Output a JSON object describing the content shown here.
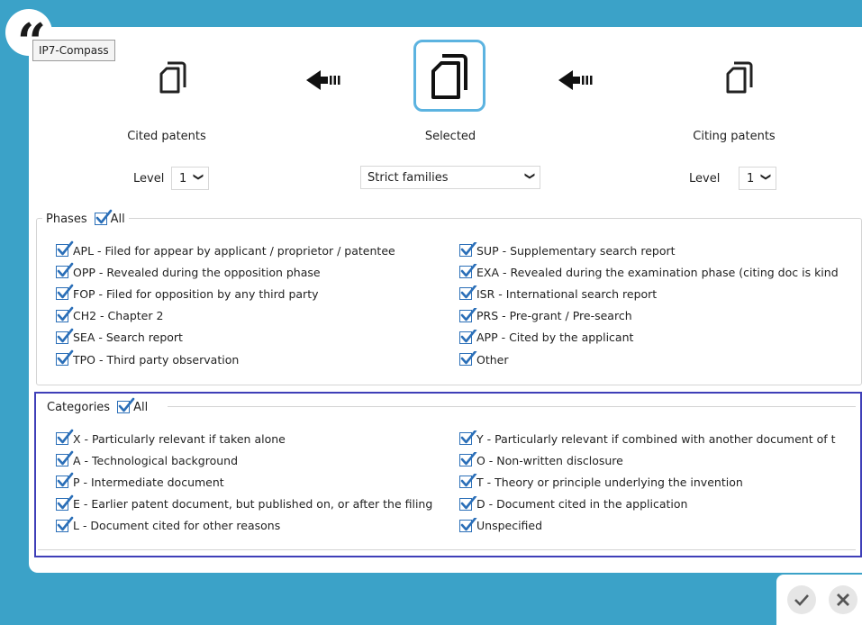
{
  "tooltip": "IP7-Compass",
  "header": {
    "cited_label": "Cited patents",
    "selected_label": "Selected",
    "citing_label": "Citing patents",
    "level_label": "Level",
    "cited_level": "1",
    "citing_level": "1",
    "family_select": "Strict families"
  },
  "phases": {
    "title": "Phases",
    "all_label": "All",
    "left": [
      "APL - Filed for appear by applicant / proprietor / patentee",
      "OPP - Revealed during the opposition phase",
      "FOP - Filed for opposition by any third party",
      "CH2 - Chapter 2",
      "SEA - Search report",
      "TPO - Third party observation"
    ],
    "right": [
      "SUP - Supplementary search report",
      "EXA - Revealed during the examination phase (citing doc is kind",
      "ISR - International search report",
      "PRS - Pre-grant / Pre-search",
      "APP - Cited by the applicant",
      "Other"
    ]
  },
  "categories": {
    "title": "Categories",
    "all_label": "All",
    "left": [
      "X - Particularly relevant if taken alone",
      "A - Technological background",
      "P - Intermediate document",
      "E - Earlier patent document, but published on, or after the filing",
      "L - Document cited for other reasons"
    ],
    "right": [
      "Y - Particularly relevant if combined with another document of t",
      "O - Non-written disclosure",
      "T - Theory or principle underlying the invention",
      "D - Document cited in the application",
      "Unspecified"
    ]
  },
  "colors": {
    "background": "#3ba2c8",
    "checkbox": "#2b6fb8",
    "selected_border": "#5cb3e0",
    "focus_border": "#3f3fb8"
  }
}
